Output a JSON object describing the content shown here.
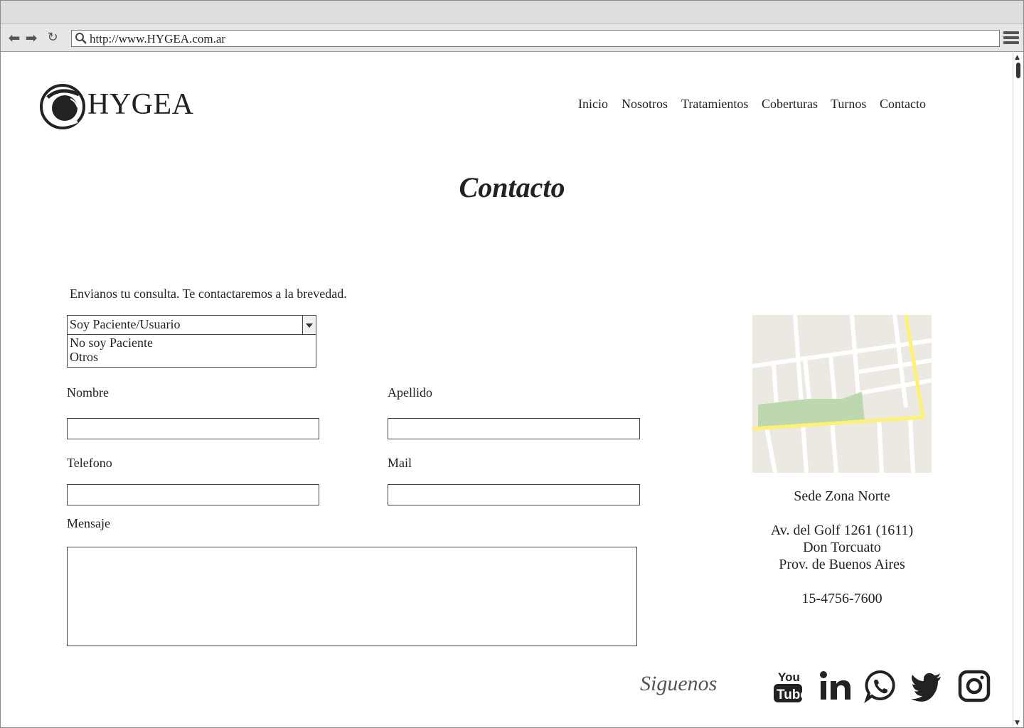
{
  "browser": {
    "url": "http://www.HYGEA.com.ar",
    "back_icon": "back-arrow-icon",
    "forward_icon": "forward-arrow-icon",
    "reload_icon": "reload-icon",
    "search_icon": "search-icon",
    "menu_icon": "hamburger-menu-icon"
  },
  "site": {
    "brand": "HYGEA",
    "nav": [
      "Inicio",
      "Nosotros",
      "Tratamientos",
      "Coberturas",
      "Turnos",
      "Contacto"
    ]
  },
  "page": {
    "title": "Contacto",
    "intro": "Envianos tu consulta. Te contactaremos a la brevedad."
  },
  "form": {
    "select": {
      "selected": "Soy Paciente/Usuario",
      "options": [
        "No soy Paciente",
        "Otros"
      ]
    },
    "nombre_label": "Nombre",
    "apellido_label": "Apellido",
    "telefono_label": "Telefono",
    "mail_label": "Mail",
    "mensaje_label": "Mensaje",
    "nombre_value": "",
    "apellido_value": "",
    "telefono_value": "",
    "mail_value": "",
    "mensaje_value": ""
  },
  "sede": {
    "name": "Sede Zona Norte",
    "address1": "Av. del Golf 1261 (1611)",
    "address2": "Don Torcuato",
    "address3": "Prov. de Buenos Aires",
    "phone": "15-4756-7600"
  },
  "social": {
    "label": "Siguenos",
    "icons": [
      "youtube-icon",
      "linkedin-icon",
      "whatsapp-icon",
      "twitter-icon",
      "instagram-icon"
    ]
  },
  "colors": {
    "text": "#222222",
    "muted": "#555555",
    "map_bg": "#ebe9e2",
    "map_park": "#bdd7ae",
    "map_road_main": "#fff176"
  }
}
